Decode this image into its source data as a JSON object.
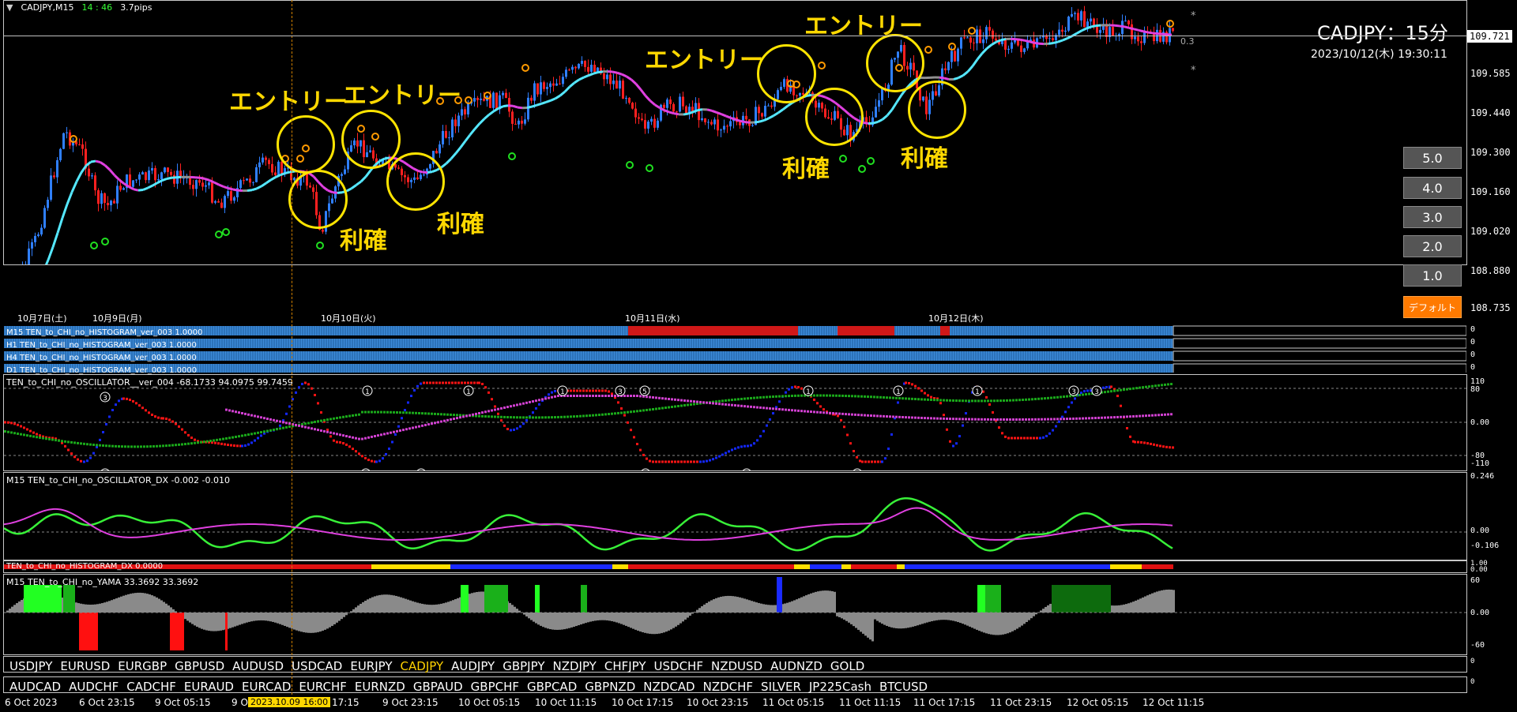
{
  "header": {
    "symbol_tf": "CADJPY,M15",
    "time": "14 : 46",
    "spread": "3.7pips"
  },
  "overlay": {
    "pair_title": "CADJPY：15分",
    "datetime": "2023/10/12(木) 19:30:11",
    "spread_right": "0.3",
    "star1": "*",
    "star2": "*"
  },
  "annotations": {
    "entry": "エントリー",
    "exit": "利確"
  },
  "main_dates": [
    "10月7日(土)",
    "10月9日(月)",
    "10月10日(火)",
    "10月11日(水)",
    "10月12日(木)"
  ],
  "price_axis": [
    "109.585",
    "109.440",
    "109.300",
    "109.160",
    "109.020",
    "108.880",
    "108.735"
  ],
  "current_price": "109.721",
  "zoom_buttons": [
    "5.0",
    "4.0",
    "3.0",
    "2.0",
    "1.0",
    "デフォルト"
  ],
  "histograms": [
    "M15 TEN_to_CHI_no_HISTOGRAM_ver_003 1.0000",
    "H1 TEN_to_CHI_no_HISTOGRAM_ver_003 1.0000",
    "H4 TEN_to_CHI_no_HISTOGRAM_ver_003 1.0000",
    "D1 TEN_to_CHI_no_HISTOGRAM_ver_003 1.0000"
  ],
  "hist_axis": [
    "0",
    "0",
    "0",
    "0"
  ],
  "oscillator": {
    "title": "TEN_to_CHI_no_OSCILLATOR__ver_004 -68.1733 94.0975 99.7459",
    "axis": [
      "110",
      "80",
      "0.00",
      "-80",
      "-110"
    ]
  },
  "oscillator_dx": {
    "title": "M15 TEN_to_CHI_no_OSCILLATOR_DX -0.002 -0.010",
    "axis": [
      "0.246",
      "0.00",
      "-0.106"
    ]
  },
  "histogram_dx": {
    "title": "TEN_to_CHI_no_HISTOGRAM_DX 0.0000",
    "axis": [
      "1.00",
      "0.00"
    ]
  },
  "yama": {
    "title": "M15 TEN_to_CHI_no_YAMA  33.3692 33.3692",
    "axis": [
      "60",
      "0.00",
      "-60"
    ]
  },
  "symbols_row1": [
    "USDJPY",
    "EURUSD",
    "EURGBP",
    "GBPUSD",
    "AUDUSD",
    "USDCAD",
    "EURJPY",
    "CADJPY",
    "AUDJPY",
    "GBPJPY",
    "NZDJPY",
    "CHFJPY",
    "USDCHF",
    "NZDUSD",
    "AUDNZD",
    "GOLD"
  ],
  "symbols_row2": [
    "AUDCAD",
    "AUDCHF",
    "CADCHF",
    "EURAUD",
    "EURCAD",
    "EURCHF",
    "EURNZD",
    "GBPAUD",
    "GBPCHF",
    "GBPCAD",
    "GBPNZD",
    "NZDCAD",
    "NZDCHF",
    "SILVER",
    "JP225Cash",
    "BTCUSD"
  ],
  "active_symbol": "CADJPY",
  "row_axis": [
    "0",
    "0"
  ],
  "time_axis": [
    "6 Oct 2023",
    "6 Oct 23:15",
    "9 Oct 05:15",
    "9 Oct",
    "17:15",
    "9 Oct 23:15",
    "10 Oct 05:15",
    "10 Oct 11:15",
    "10 Oct 17:15",
    "10 Oct 23:15",
    "11 Oct 05:15",
    "11 Oct 11:15",
    "11 Oct 17:15",
    "11 Oct 23:15",
    "12 Oct 05:15",
    "12 Oct 11:15"
  ],
  "time_cursor": "2023.10.09 16:00",
  "colors": {
    "bull": "#2f7fff",
    "bear": "#ff2020",
    "ema_cyan": "#55e8ff",
    "ema_magenta": "#e040e0",
    "ema_gray": "#909090",
    "annotation": "#ffe400",
    "hist_blue": "#3c8ad8",
    "hist_red": "#d01818"
  }
}
